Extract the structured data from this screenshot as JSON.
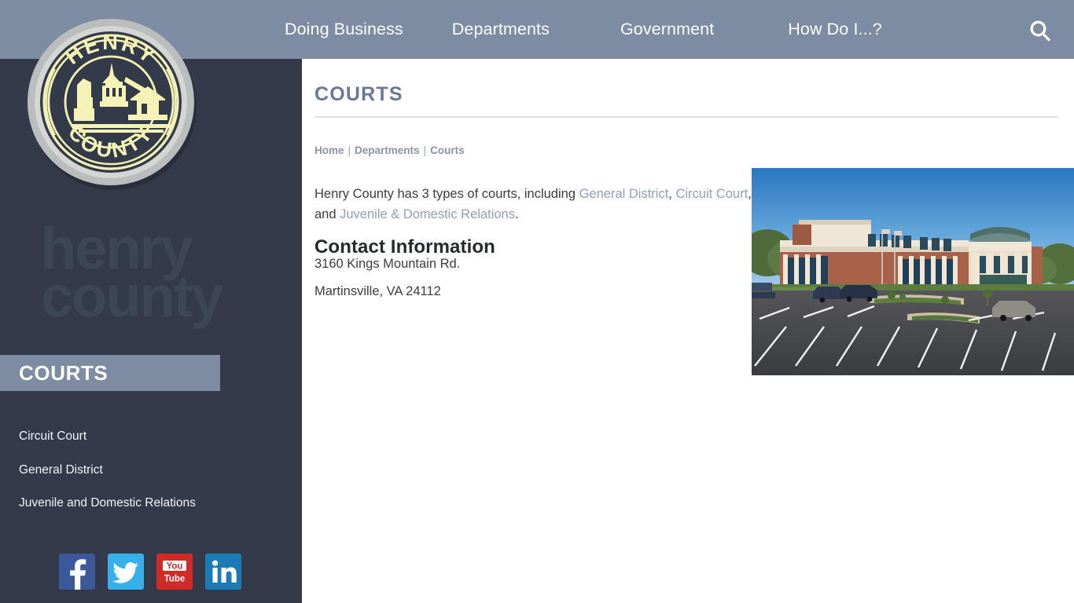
{
  "site": {
    "logo_top_text": "HENRY",
    "logo_bottom_text": "COUNTY",
    "watermark_line1": "henry",
    "watermark_line2": "county"
  },
  "topnav": {
    "items": [
      {
        "label": "Doing Business"
      },
      {
        "label": "Departments"
      },
      {
        "label": "Government"
      },
      {
        "label": "How Do I...?"
      }
    ],
    "search_icon": "search-icon"
  },
  "sidebar": {
    "section_title": "COURTS",
    "links": [
      {
        "label": "Circuit Court"
      },
      {
        "label": "General District"
      },
      {
        "label": "Juvenile and Domestic Relations"
      }
    ],
    "social": [
      {
        "name": "facebook-icon",
        "label": "Facebook",
        "color": "#3b5998"
      },
      {
        "name": "twitter-icon",
        "label": "Twitter",
        "color": "#35b0ea"
      },
      {
        "name": "youtube-icon",
        "label": "YouTube",
        "color": "#d12b28"
      },
      {
        "name": "linkedin-icon",
        "label": "LinkedIn",
        "color": "#1c7bb5"
      }
    ]
  },
  "main": {
    "page_title": "COURTS",
    "breadcrumb": {
      "home": "Home",
      "departments": "Departments",
      "current": "Courts",
      "separator": "|"
    },
    "intro": {
      "text_1": "Henry County has 3 types of courts, including ",
      "link_1": "General District",
      "text_2": ", ",
      "link_2": "Circuit Court",
      "text_3": ", and ",
      "link_3": "Juvenile & Domestic Relations",
      "text_4": "."
    },
    "contact_heading": "Contact Information",
    "address_line1": "3160 Kings Mountain Rd.",
    "address_line2": "Martinsville, VA 24112",
    "photo_alt": "Henry County Courthouse building with parking lot"
  },
  "colors": {
    "header_bg": "#7e8ca3",
    "sidebar_bg": "#333b4a",
    "accent": "#6b7894",
    "link": "#90a0b8",
    "body_text": "#3c3c3c"
  }
}
